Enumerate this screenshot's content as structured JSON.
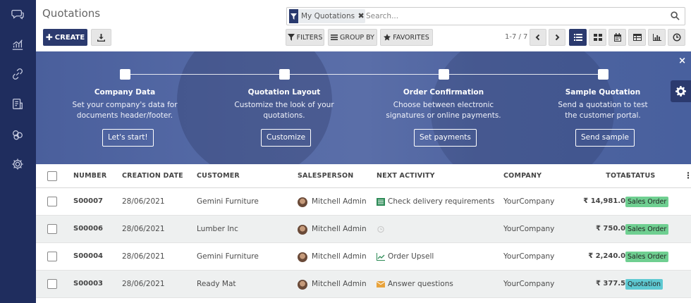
{
  "sidebar": {
    "icons": [
      "discuss-icon",
      "chart-icon",
      "link-icon",
      "document-icon",
      "coins-icon",
      "settings-icon"
    ]
  },
  "header": {
    "title": "Quotations"
  },
  "search": {
    "facet_label": "My Quotations",
    "placeholder": "Search..."
  },
  "toolbar": {
    "create_label": "CREATE",
    "filters_label": "FILTERS",
    "group_by_label": "GROUP BY",
    "favorites_label": "FAVORITES",
    "pager": "1-7 / 7",
    "active_view": "list"
  },
  "banner": {
    "steps": [
      {
        "title": "Company Data",
        "desc": "Set your company's data for documents header/footer.",
        "button": "Let's start!"
      },
      {
        "title": "Quotation Layout",
        "desc": "Customize the look of your quotations.",
        "button": "Customize"
      },
      {
        "title": "Order Confirmation",
        "desc": "Choose between electronic signatures or online payments.",
        "button": "Set payments"
      },
      {
        "title": "Sample Quotation",
        "desc": "Send a quotation to test the customer portal.",
        "button": "Send sample"
      }
    ],
    "close": "×"
  },
  "table": {
    "columns": [
      "NUMBER",
      "CREATION DATE",
      "CUSTOMER",
      "SALESPERSON",
      "NEXT ACTIVITY",
      "COMPANY",
      "TOTAL",
      "STATUS"
    ],
    "rows": [
      {
        "number": "S00007",
        "date": "28/06/2021",
        "customer": "Gemini Furniture",
        "salesperson": "Mitchell Admin",
        "activity": "Check delivery requirements",
        "activity_icon": "checklist-icon",
        "company": "YourCompany",
        "total": "₹ 14,981.00",
        "status": "Sales Order"
      },
      {
        "number": "S00006",
        "date": "28/06/2021",
        "customer": "Lumber Inc",
        "salesperson": "Mitchell Admin",
        "activity": "",
        "activity_icon": "clock-icon",
        "company": "YourCompany",
        "total": "₹ 750.00",
        "status": "Sales Order"
      },
      {
        "number": "S00004",
        "date": "28/06/2021",
        "customer": "Gemini Furniture",
        "salesperson": "Mitchell Admin",
        "activity": "Order Upsell",
        "activity_icon": "upsell-chart-icon",
        "company": "YourCompany",
        "total": "₹ 2,240.00",
        "status": "Sales Order"
      },
      {
        "number": "S00003",
        "date": "28/06/2021",
        "customer": "Ready Mat",
        "salesperson": "Mitchell Admin",
        "activity": "Answer questions",
        "activity_icon": "envelope-icon",
        "company": "YourCompany",
        "total": "₹ 377.50",
        "status": "Quotation"
      }
    ]
  },
  "colors": {
    "sidebar": "#1f2d5e",
    "primary": "#2b3a6e",
    "sales_order": "#6fcf91",
    "quotation": "#5ec9d2"
  }
}
